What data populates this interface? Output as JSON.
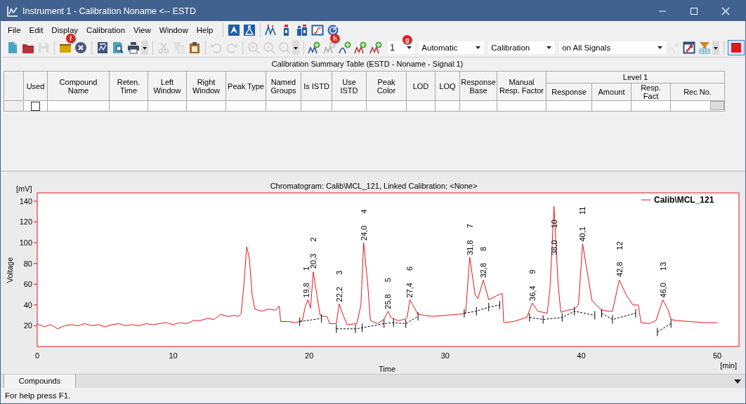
{
  "window": {
    "title": "Instrument 1 - Calibration Noname <-- ESTD"
  },
  "menu": [
    "File",
    "Edit",
    "Display",
    "Calibration",
    "View",
    "Window",
    "Help"
  ],
  "toolbar_top": [
    {
      "kind": "separator"
    },
    {
      "kind": "a-logo",
      "disabled": false
    },
    {
      "kind": "flask",
      "disabled": false
    },
    {
      "kind": "separator"
    },
    {
      "kind": "peaks-marker",
      "disabled": false
    },
    {
      "kind": "bottle",
      "disabled": false
    },
    {
      "kind": "bottles",
      "disabled": false
    },
    {
      "kind": "chart-window",
      "disabled": false
    },
    {
      "kind": "target",
      "disabled": false
    }
  ],
  "toolbar": [
    {
      "kind": "new",
      "disabled": false
    },
    {
      "kind": "open",
      "disabled": false
    },
    {
      "kind": "save",
      "disabled": true
    },
    {
      "kind": "separator"
    },
    {
      "kind": "folder",
      "disabled": false,
      "badge": "f"
    },
    {
      "kind": "close",
      "disabled": false
    },
    {
      "kind": "separator"
    },
    {
      "kind": "report",
      "disabled": false
    },
    {
      "kind": "preview",
      "disabled": false
    },
    {
      "kind": "printer",
      "disabled": false
    },
    {
      "kind": "dropdown"
    },
    {
      "kind": "separator"
    },
    {
      "kind": "cut",
      "disabled": true
    },
    {
      "kind": "copy",
      "disabled": true
    },
    {
      "kind": "paste",
      "disabled": false
    },
    {
      "kind": "separator"
    },
    {
      "kind": "undo",
      "disabled": true
    },
    {
      "kind": "redo",
      "disabled": true
    },
    {
      "kind": "separator"
    },
    {
      "kind": "zoom-prev",
      "disabled": true
    },
    {
      "kind": "zoom-next",
      "disabled": true
    },
    {
      "kind": "zoom",
      "disabled": true
    },
    {
      "kind": "dropdown"
    },
    {
      "kind": "separator"
    },
    {
      "kind": "peak-add",
      "disabled": false
    },
    {
      "kind": "peak-add",
      "disabled": true,
      "badge": "h"
    },
    {
      "kind": "peak-add-single",
      "disabled": false
    },
    {
      "kind": "peak-add-group",
      "disabled": false
    },
    {
      "kind": "peak-add-group",
      "disabled": false
    },
    {
      "kind": "spinner",
      "value": "1",
      "badge": "g"
    },
    {
      "kind": "combo",
      "value": "Automatic"
    },
    {
      "kind": "combo",
      "value": "Calibration"
    },
    {
      "kind": "combo",
      "value": "on All Signals"
    },
    {
      "kind": "peak-remove",
      "disabled": true
    },
    {
      "kind": "window-wrench",
      "disabled": false
    },
    {
      "kind": "filter-grid",
      "disabled": false
    },
    {
      "kind": "dropdown"
    },
    {
      "kind": "separator"
    },
    {
      "kind": "stop",
      "disabled": false,
      "pressed": true
    }
  ],
  "table": {
    "title": "Calibration Summary Table (ESTD - Noname - Signal 1)",
    "columns": [
      "Used",
      "Compound Name",
      "Reten. Time",
      "Left Window",
      "Right Window",
      "Peak Type",
      "Named Groups",
      "Is ISTD",
      "Use ISTD",
      "Peak Color",
      "LOD",
      "LOQ",
      "Response Base",
      "Manual Resp. Factor"
    ],
    "group": {
      "label": "Level 1",
      "columns": [
        "Response",
        "Amount",
        "Resp. Fact",
        "Rec No."
      ]
    },
    "rows": [
      {
        "used": false
      }
    ]
  },
  "chart": {
    "chart_data": {
      "type": "line",
      "title": "Chromatogram: Calib\\MCL_121, Linked Calibration: <None>",
      "xlabel": "Time",
      "ylabel": "Voltage",
      "xlim": [
        0,
        51.6
      ],
      "ylim": [
        0,
        148
      ],
      "xticks": [
        0,
        10,
        20,
        30,
        40,
        50
      ],
      "yticks": [
        20,
        40,
        60,
        80,
        100,
        120,
        140
      ],
      "x": [
        0,
        0.5,
        1,
        1.5,
        2,
        2.5,
        3,
        3.5,
        4,
        4.5,
        5,
        5.5,
        6,
        6.5,
        7,
        7.5,
        8,
        8.5,
        9,
        9.5,
        10,
        10.5,
        11,
        11.5,
        12,
        12.5,
        13,
        13.5,
        14,
        14.5,
        14.8,
        15,
        15.2,
        15.4,
        15.6,
        15.8,
        16,
        16.5,
        17,
        17.5,
        17.8,
        17.9,
        18.5,
        19,
        19.5,
        19.7,
        19.9,
        20.1,
        20.3,
        20.5,
        20.8,
        21,
        21.3,
        21.5,
        22,
        22.2,
        22.5,
        22.8,
        23.5,
        23.8,
        24,
        24.3,
        24.5,
        25,
        25.5,
        25.8,
        26,
        26.5,
        27,
        27.2,
        27.4,
        27.7,
        28,
        28.5,
        29,
        30,
        31,
        31.5,
        31.8,
        32.2,
        32.4,
        32.8,
        33.2,
        33.8,
        34.2,
        34.3,
        35,
        36,
        36.4,
        36.8,
        37.5,
        37.7,
        38,
        38.3,
        38.5,
        39,
        39.5,
        39.8,
        40.1,
        40.4,
        40.8,
        41.5,
        42,
        42.3,
        42.8,
        43.3,
        43.8,
        44.2,
        44.4,
        45,
        45.5,
        46,
        46.4,
        46.6,
        47,
        48,
        49,
        50
      ],
      "series": [
        {
          "name": "Calib\\MCL_121",
          "color": "#e8141c",
          "values": [
            22,
            19,
            21,
            17,
            20,
            21,
            20,
            22,
            20,
            21,
            19,
            21,
            22,
            20,
            21,
            20,
            22,
            21,
            22,
            23,
            21,
            23,
            22,
            25,
            25,
            27,
            26,
            31,
            29,
            30,
            29,
            32,
            60,
            96,
            85,
            50,
            36,
            34,
            36,
            35,
            39,
            24,
            24,
            23,
            25,
            38,
            45,
            37,
            72,
            55,
            30,
            29,
            29,
            22,
            22,
            41,
            30,
            21,
            22,
            40,
            100,
            60,
            25,
            22,
            26,
            34,
            28,
            25,
            26,
            28,
            45,
            38,
            31,
            30,
            29,
            30,
            31,
            32,
            86,
            50,
            46,
            64,
            45,
            49,
            51,
            23,
            24,
            28,
            42,
            34,
            32,
            55,
            135,
            60,
            33,
            35,
            36,
            40,
            99,
            75,
            44,
            35,
            34,
            34,
            64,
            50,
            40,
            40,
            23,
            22,
            25,
            45,
            35,
            26,
            25,
            24,
            23,
            23
          ]
        },
        {
          "color": "#000000",
          "line_style": "dashed",
          "x": [
            19.3,
            20.9,
            null,
            22.0,
            23.4,
            23.9,
            25.5,
            26.2,
            27.1,
            28,
            null,
            31.4,
            32.3,
            33.2,
            34.0,
            null,
            36.2,
            37.2,
            38.6,
            39.5,
            41,
            null,
            41.5,
            42.3,
            44,
            null,
            45.6,
            46.6
          ],
          "values": [
            24,
            27,
            null,
            17,
            17,
            18,
            22,
            23,
            22,
            29,
            null,
            32,
            34,
            38,
            40,
            null,
            28,
            26,
            28,
            34,
            30,
            null,
            32,
            26,
            32,
            null,
            14,
            22
          ]
        }
      ],
      "annotations": [
        {
          "x": 19.8,
          "y": 47,
          "text": "19,8 1"
        },
        {
          "x": 20.3,
          "y": 75,
          "text": "20,3 2"
        },
        {
          "x": 22.2,
          "y": 43,
          "text": "22,2 3"
        },
        {
          "x": 24.0,
          "y": 102,
          "text": "24,0 4"
        },
        {
          "x": 25.8,
          "y": 36,
          "text": "25,8 5"
        },
        {
          "x": 27.4,
          "y": 47,
          "text": "27,4 6"
        },
        {
          "x": 31.8,
          "y": 88,
          "text": "31,8 7"
        },
        {
          "x": 32.8,
          "y": 66,
          "text": "32,8 8"
        },
        {
          "x": 36.4,
          "y": 44,
          "text": "36,4 9"
        },
        {
          "x": 38.0,
          "y": 88,
          "text": "38,0 10"
        },
        {
          "x": 40.1,
          "y": 101,
          "text": "40,1 11"
        },
        {
          "x": 42.8,
          "y": 67,
          "text": "42,8 12"
        },
        {
          "x": 46.0,
          "y": 47,
          "text": "46,0 13"
        }
      ]
    },
    "x_unit": "[min]",
    "y_unit": "[mV]"
  },
  "bottom_tabs": [
    {
      "label": "Compounds",
      "selected": true
    }
  ],
  "status_bar": "For help press F1."
}
